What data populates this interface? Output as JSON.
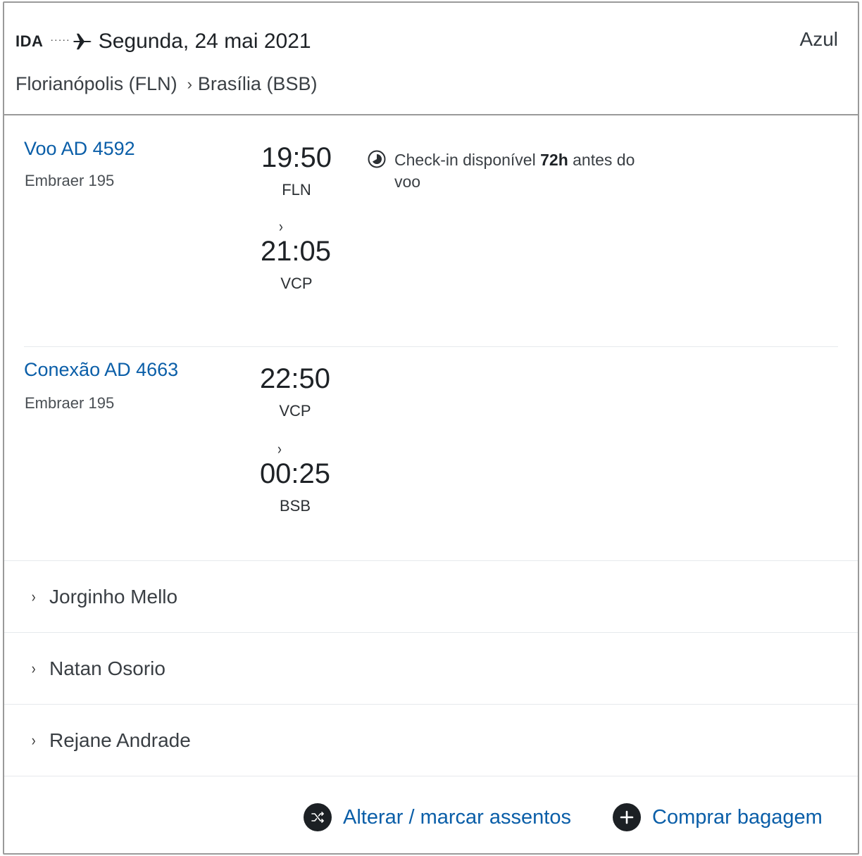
{
  "header": {
    "direction": "IDA",
    "dots": "·····",
    "date": "Segunda, 24 mai 2021",
    "airline": "Azul",
    "origin": "Florianópolis (FLN)",
    "route_separator": "›",
    "destination": "Brasília (BSB)"
  },
  "segments": [
    {
      "flight": "Voo AD 4592",
      "aircraft": "Embraer 195",
      "departure_time": "19:50",
      "departure_code": "FLN",
      "chevron": "›",
      "arrival_time": "21:05",
      "arrival_code": "VCP"
    },
    {
      "flight": "Conexão AD 4663",
      "aircraft": "Embraer 195",
      "departure_time": "22:50",
      "departure_code": "VCP",
      "chevron": "›",
      "arrival_time": "00:25",
      "arrival_code": "BSB"
    }
  ],
  "checkin": {
    "prefix": "Check-in disponível ",
    "hours": "72h",
    "suffix": " antes do voo"
  },
  "passengers": [
    {
      "caret": "›",
      "name": "Jorginho Mello"
    },
    {
      "caret": "›",
      "name": "Natan Osorio"
    },
    {
      "caret": "›",
      "name": "Rejane Andrade"
    }
  ],
  "actions": {
    "seats_label": "Alterar / marcar assentos",
    "baggage_label": "Comprar bagagem"
  },
  "colors": {
    "link": "#0a5ea8",
    "icon_bg": "#1c2024",
    "border": "#9a9a9a"
  },
  "icons": [
    "plane-icon",
    "clock-icon",
    "shuffle-icon",
    "plus-icon"
  ]
}
